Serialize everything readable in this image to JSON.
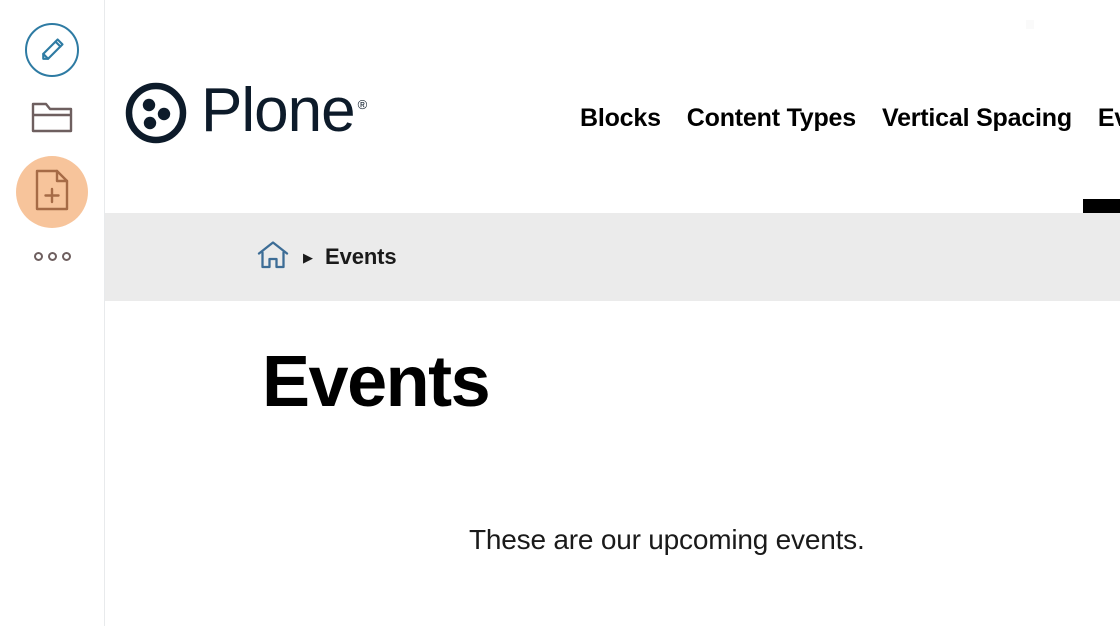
{
  "toolbar": {
    "items": [
      {
        "name": "edit",
        "icon": "pencil-icon",
        "label": "Edit"
      },
      {
        "name": "folder-contents",
        "icon": "folder-icon",
        "label": "Contents"
      },
      {
        "name": "add-content",
        "icon": "document-add-icon",
        "label": "Add",
        "active": true,
        "color": "#f7c49b"
      },
      {
        "name": "more",
        "icon": "ellipsis-icon",
        "label": "More"
      }
    ]
  },
  "header": {
    "logo": {
      "text": "Plone",
      "trademark": "®",
      "mark": "plone-logo-icon"
    },
    "nav": [
      {
        "label": "Blocks",
        "active": false
      },
      {
        "label": "Content Types",
        "active": false
      },
      {
        "label": "Vertical Spacing",
        "active": false
      },
      {
        "label": "Eve",
        "active": true
      }
    ],
    "accent_color": "#000000"
  },
  "breadcrumb": {
    "home_icon": "home-icon",
    "separator": "▶",
    "items": [
      {
        "label": "Events"
      }
    ]
  },
  "content": {
    "title": "Events",
    "description": "These are our upcoming events."
  },
  "colors": {
    "brand_dark": "#0d1b2a",
    "toolbar_edit": "#2e7ba3",
    "toolbar_folder": "#6e5f5f",
    "toolbar_add_bg": "#f7c49b",
    "toolbar_add_fg": "#a66b46",
    "breadcrumb_bg": "#ebebeb",
    "home_icon": "#3d6d96"
  }
}
